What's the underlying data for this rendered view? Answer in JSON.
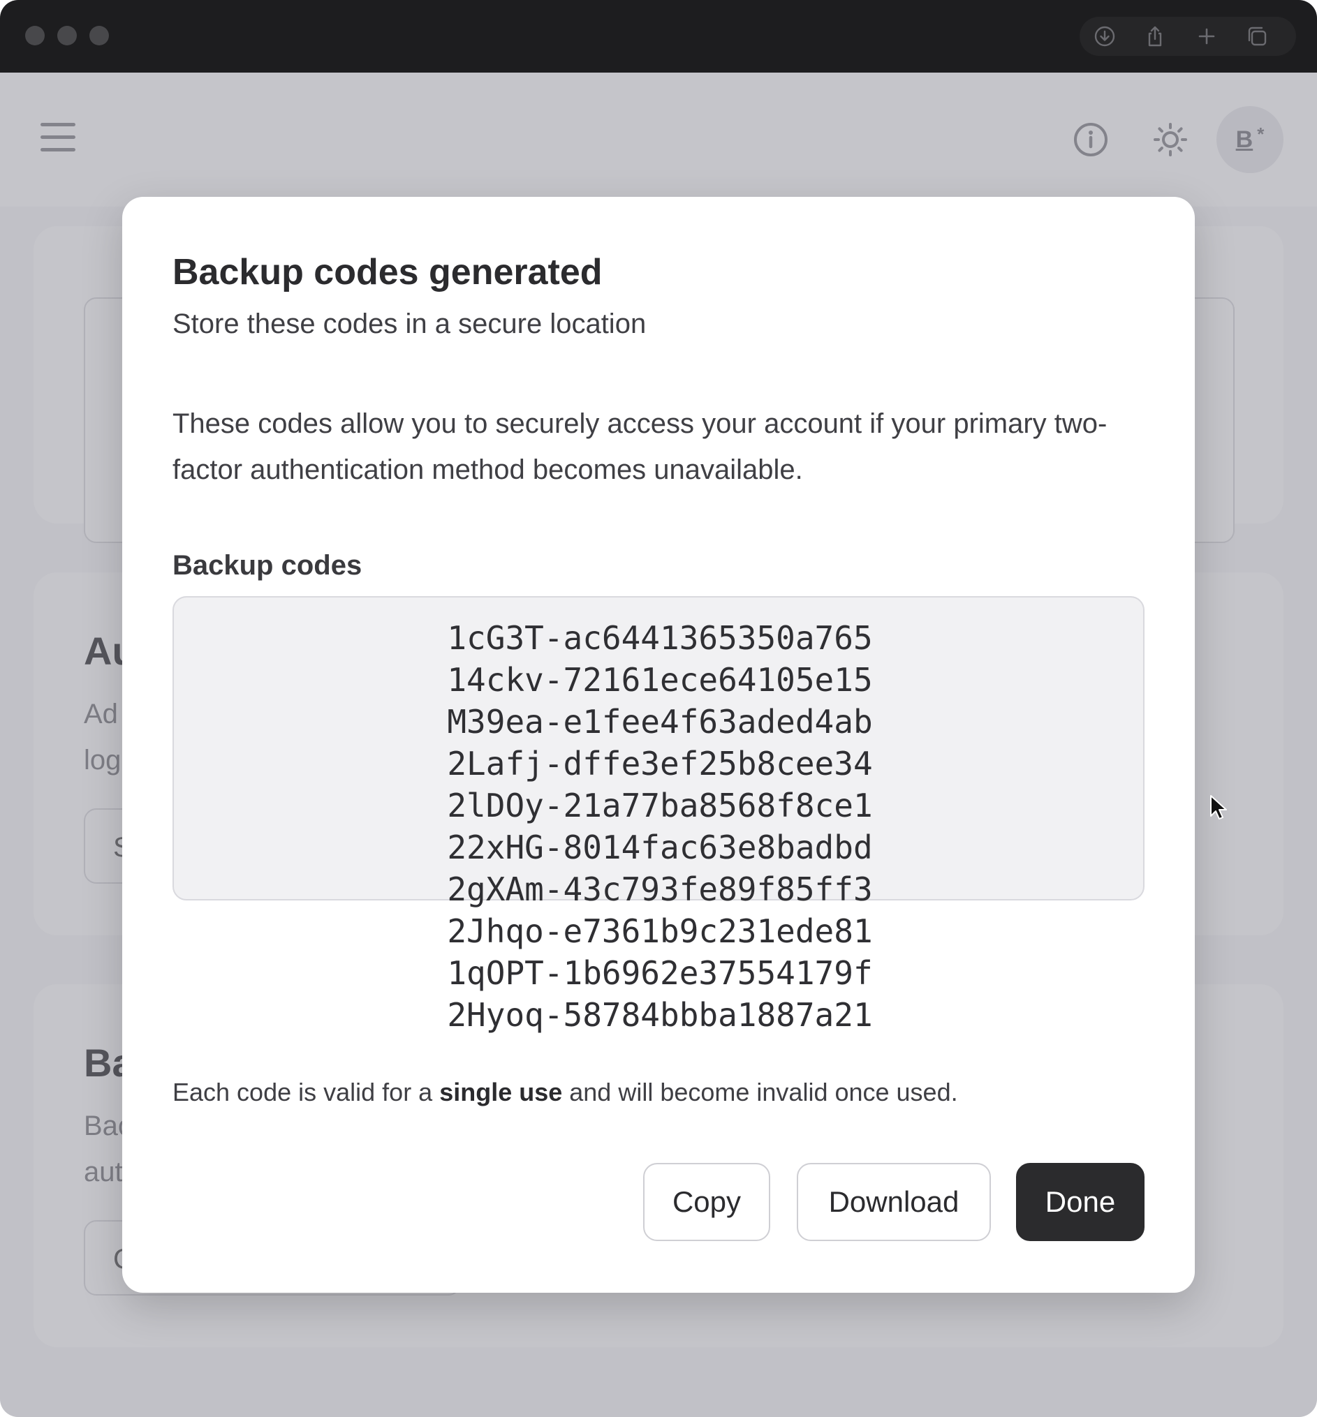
{
  "window": {
    "toolbar_icons": [
      "download-icon",
      "share-icon",
      "new-tab-icon",
      "tabs-overview-icon"
    ]
  },
  "header": {
    "menu_icon": "hamburger-menu-icon",
    "info_icon": "info-icon",
    "theme_icon": "sun-icon",
    "avatar": {
      "initial": "B",
      "badge": "*"
    }
  },
  "background": {
    "card2": {
      "title_fragment": "Au",
      "text_line1": "Ad",
      "text_line2": "log",
      "button_fragment": "S"
    },
    "card3": {
      "title_fragment": "Ba",
      "text_line1": "Bac",
      "text_line2": "aut",
      "button_fragment": "C"
    }
  },
  "modal": {
    "title": "Backup codes generated",
    "subtitle": "Store these codes in a secure location",
    "description": "These codes allow you to securely access your account if your primary two-factor authentication method becomes unavailable.",
    "codes_label": "Backup codes",
    "codes": [
      "1cG3T-ac6441365350a765",
      "14ckv-72161ece64105e15",
      "M39ea-e1fee4f63aded4ab",
      "2Lafj-dffe3ef25b8cee34",
      "2lDOy-21a77ba8568f8ce1",
      "22xHG-8014fac63e8badbd",
      "2gXAm-43c793fe89f85ff3",
      "2Jhqo-e7361b9c231ede81",
      "1qOPT-1b6962e37554179f",
      "2Hyoq-58784bbba1887a21"
    ],
    "note_before": "Each code is valid for a ",
    "note_bold": "single use",
    "note_after": " and will become invalid once used.",
    "buttons": {
      "copy": "Copy",
      "download": "Download",
      "done": "Done"
    }
  }
}
